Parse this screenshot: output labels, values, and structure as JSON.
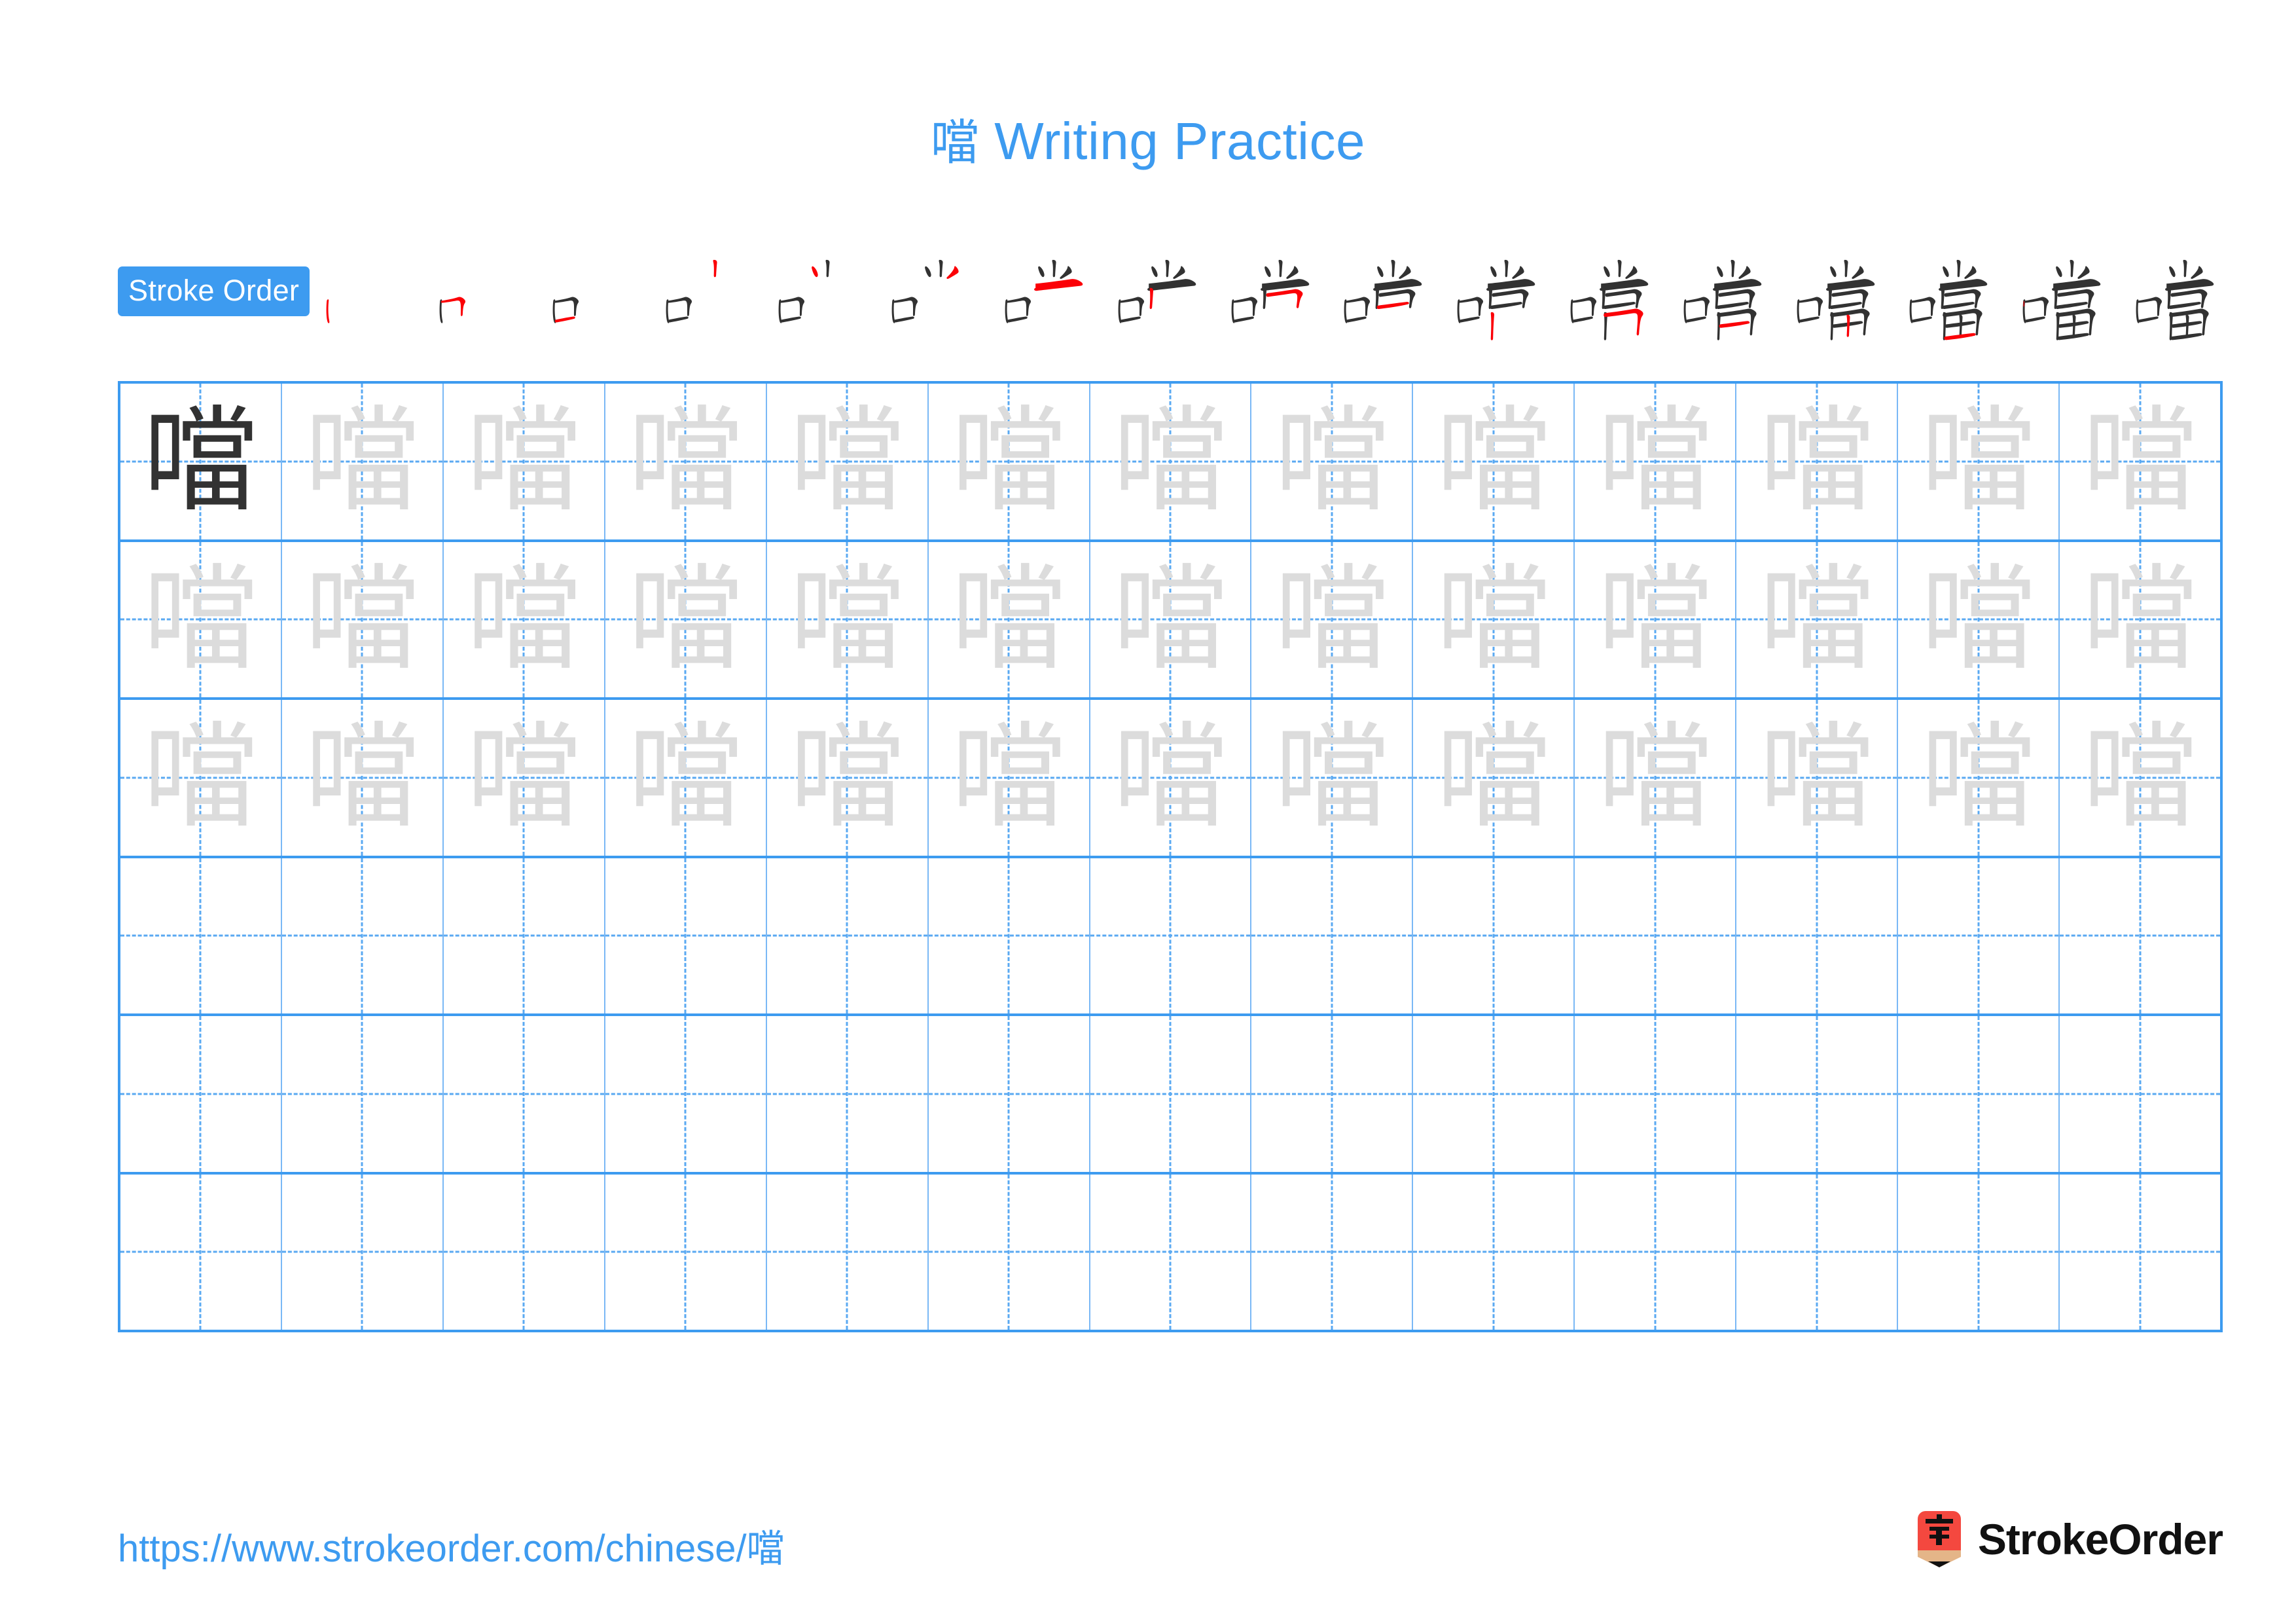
{
  "page": {
    "character": "噹",
    "title_suffix": " Writing Practice",
    "accent_color": "#3d9bf0",
    "trace_color": "#dcdcdc",
    "model_color": "#323232",
    "highlight_color": "#fb0007"
  },
  "stroke_order": {
    "badge_label": "Stroke Order",
    "total_strokes": 17,
    "steps": [
      {
        "index": 1,
        "new_stroke": "丨 (shù) — left vertical of 口"
      },
      {
        "index": 2,
        "new_stroke": "𠃍 (héngzhé) — top + right of 口"
      },
      {
        "index": 3,
        "new_stroke": "一 (héng) — bottom of 口"
      },
      {
        "index": 4,
        "new_stroke": "丨 (shù) — left dot stroke of 尚 top"
      },
      {
        "index": 5,
        "new_stroke": "丶 (diǎn) — left dot of 尚 top"
      },
      {
        "index": 6,
        "new_stroke": "丿 (piě) — right dot of 尚 top"
      },
      {
        "index": 7,
        "new_stroke": "丨 (shù) — center vertical of 尚 top"
      },
      {
        "index": 8,
        "new_stroke": "乛 (héngzhégōu) — horizontal hook of 尚"
      },
      {
        "index": 9,
        "new_stroke": "丨 (shù) — left vertical under 尚 crown"
      },
      {
        "index": 10,
        "new_stroke": "𠃍 (héngzhé) — right turn of 尚 box"
      },
      {
        "index": 11,
        "new_stroke": "一 (héng) — closing stroke of 尚 box"
      },
      {
        "index": 12,
        "new_stroke": "丨 (shù) — left vertical of 田"
      },
      {
        "index": 13,
        "new_stroke": "𠃍 (héngzhé) — top + right of 田"
      },
      {
        "index": 14,
        "new_stroke": "一 (héng) — middle horizontal of 田"
      },
      {
        "index": 15,
        "new_stroke": "丨 (shù) — middle vertical of 田"
      },
      {
        "index": 16,
        "new_stroke": "一 (héng) — bottom of 田"
      },
      {
        "index": 17,
        "new_stroke": "complete 噹"
      }
    ]
  },
  "grid": {
    "columns": 13,
    "rows": 6,
    "traced_rows": 3,
    "empty_rows": 3,
    "model_cell": {
      "row": 1,
      "column": 1
    },
    "cell_character": "噹"
  },
  "footer": {
    "url": "https://www.strokeorder.com/chinese/噹",
    "brand_name": "StrokeOrder",
    "logo_character": "字",
    "logo_body_color": "#f4483f",
    "logo_wood_color": "#e4b588",
    "logo_tip_color": "#111111"
  }
}
